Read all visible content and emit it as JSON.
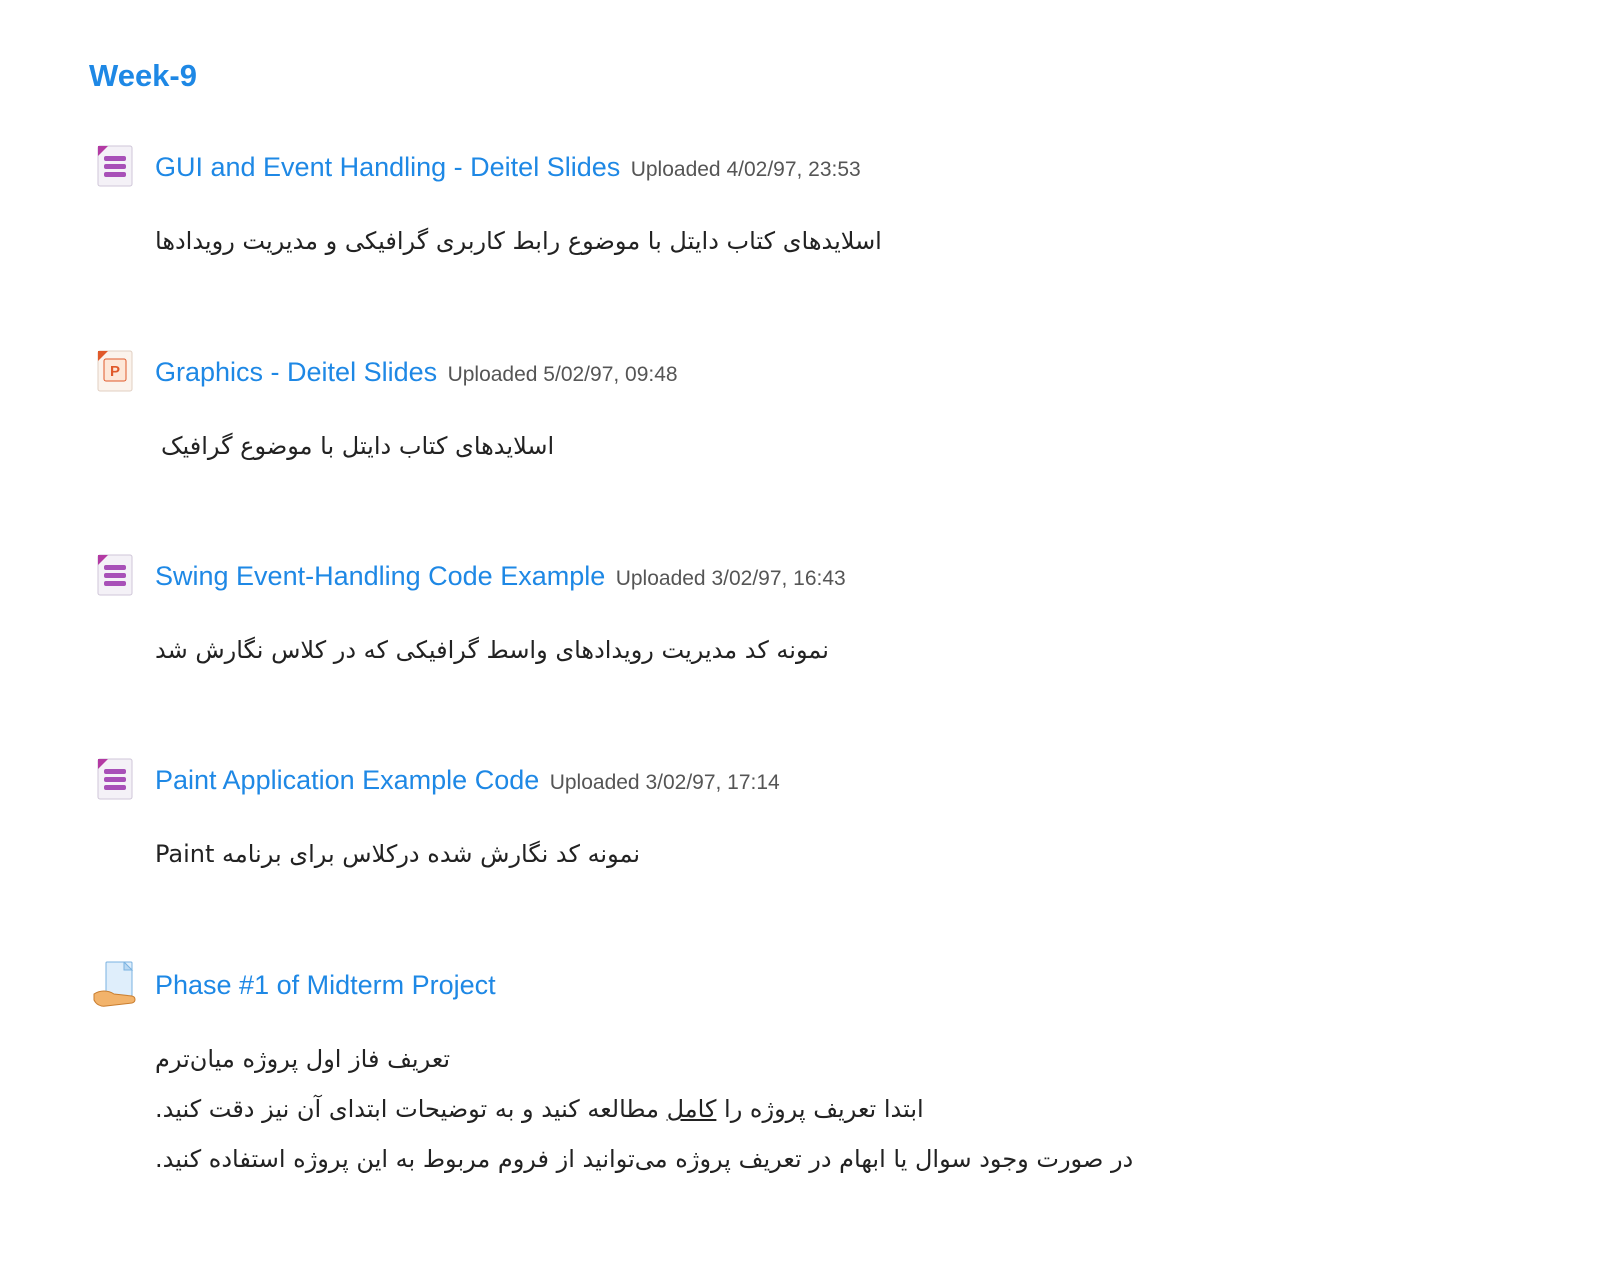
{
  "section": {
    "title": "Week-9"
  },
  "activities": [
    {
      "icon": "document-icon",
      "title": "GUI and Event Handling - Deitel Slides",
      "uploaded": "Uploaded 4/02/97, 23:53",
      "description": "اسلایدهای کتاب دایتل با موضوع رابط کاربری گرافیکی و مدیریت رویدادها"
    },
    {
      "icon": "powerpoint-icon",
      "title": "Graphics - Deitel Slides",
      "uploaded": "Uploaded 5/02/97, 09:48",
      "description": "اسلایدهای کتاب دایتل با موضوع گرافیک"
    },
    {
      "icon": "document-icon",
      "title": "Swing Event-Handling Code Example",
      "uploaded": "Uploaded 3/02/97, 16:43",
      "description": "نمونه کد مدیریت رویدادهای واسط گرافیکی که در کلاس نگارش شد"
    },
    {
      "icon": "document-icon",
      "title": "Paint Application Example Code",
      "uploaded": "Uploaded 3/02/97, 17:14",
      "description": "نمونه کد نگارش شده درکلاس برای برنامه Paint"
    },
    {
      "icon": "assignment-icon",
      "title": "Phase #1 of Midterm Project",
      "description_line1": "تعریف فاز اول پروژه میان‌ترم",
      "description_line2_a": "ابتدا تعریف پروژه را ",
      "description_line2_b": "کامل",
      "description_line2_c": " مطالعه کنید و به توضیحات ابتدای آن نیز دقت کنید.",
      "description_line3": "در صورت وجود سوال یا ابهام در تعریف پروژه می‌توانید از فروم مربوط به این پروژه استفاده کنید."
    }
  ]
}
